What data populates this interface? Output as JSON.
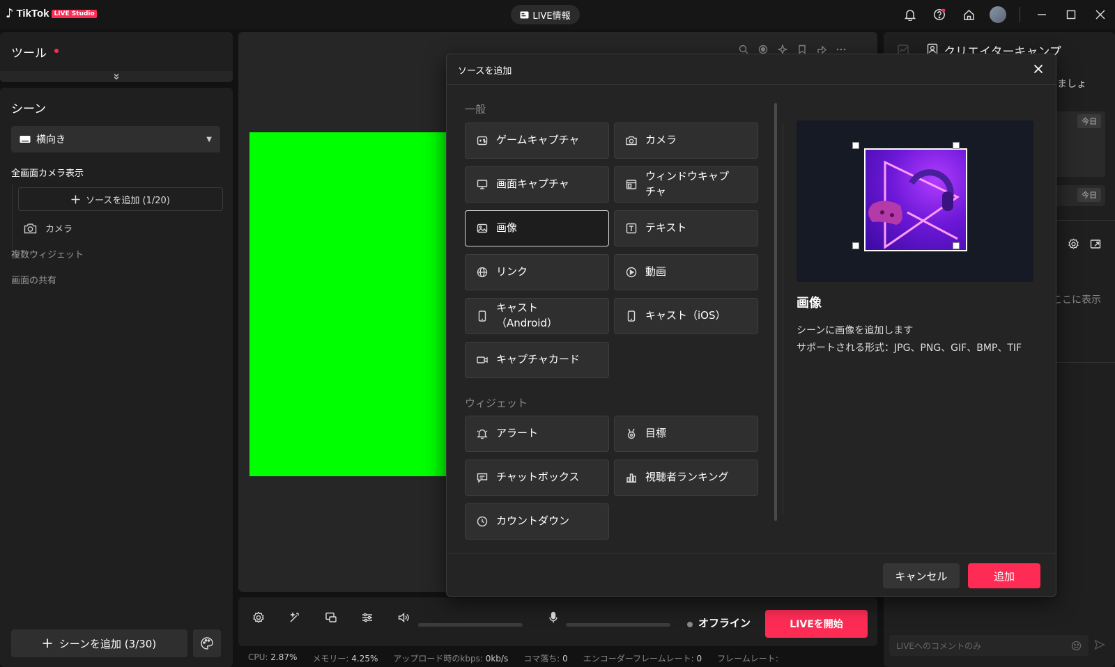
{
  "app": {
    "brand": "TikTok",
    "badge": "LIVE Studio",
    "live_info": "LIVE情報"
  },
  "tools": {
    "title": "ツール"
  },
  "scenes": {
    "title": "シーン",
    "selected": "横向き",
    "scene_name": "全画面カメラ表示",
    "add_source": "ソースを追加 (1/20)",
    "camera": "カメラ",
    "items": [
      "複数ウィジェット",
      "画面の共有"
    ],
    "add_scene": "シーンを追加 (3/30)"
  },
  "bottombar": {
    "status": "オフライン",
    "go_live": "LIVEを開始",
    "stats": [
      {
        "label": "CPU:",
        "value": "2.87%"
      },
      {
        "label": "メモリー:",
        "value": "4.25%"
      },
      {
        "label": "アップロード時のkbps:",
        "value": "0kb/s"
      },
      {
        "label": "コマ落ち:",
        "value": "0"
      },
      {
        "label": "エンコーダーフレームレート:",
        "value": "0"
      },
      {
        "label": "フレームレート:",
        "value": ""
      }
    ]
  },
  "right": {
    "title": "クリエイターキャンプ",
    "snippet1": "みましょ",
    "today1": "今日",
    "today2": "今日",
    "snippet2": "ここに表示",
    "comment_placeholder": "LIVEへのコメントのみ"
  },
  "dialog": {
    "title": "ソースを追加",
    "general_label": "一般",
    "widget_label": "ウィジェット",
    "general": [
      {
        "label": "ゲームキャプチャ",
        "icon": "game-capture-icon"
      },
      {
        "label": "カメラ",
        "icon": "camera-icon"
      },
      {
        "label": "画面キャプチャ",
        "icon": "monitor-icon"
      },
      {
        "label": "ウィンドウキャプチャ",
        "icon": "window-icon"
      },
      {
        "label": "画像",
        "icon": "image-icon"
      },
      {
        "label": "テキスト",
        "icon": "text-icon"
      },
      {
        "label": "リンク",
        "icon": "globe-icon"
      },
      {
        "label": "動画",
        "icon": "play-icon"
      },
      {
        "label": "キャスト（Android）",
        "icon": "phone-icon"
      },
      {
        "label": "キャスト（iOS）",
        "icon": "phone-icon"
      },
      {
        "label": "キャプチャカード",
        "icon": "video-camera-icon"
      }
    ],
    "widgets": [
      {
        "label": "アラート",
        "icon": "bell-icon"
      },
      {
        "label": "目標",
        "icon": "medal-icon"
      },
      {
        "label": "チャットボックス",
        "icon": "chat-icon"
      },
      {
        "label": "視聴者ランキング",
        "icon": "bar-chart-icon"
      },
      {
        "label": "カウントダウン",
        "icon": "clock-icon"
      }
    ],
    "selected_index": 4,
    "info_title": "画像",
    "info_line1": "シーンに画像を追加します",
    "info_line2": "サポートされる形式：JPG、PNG、GIF、BMP、TIF",
    "cancel": "キャンセル",
    "add": "追加"
  },
  "colors": {
    "accent": "#fe2c55",
    "preview_green": "#00ff00",
    "panel": "#1f1f1f",
    "background": "#121212"
  }
}
